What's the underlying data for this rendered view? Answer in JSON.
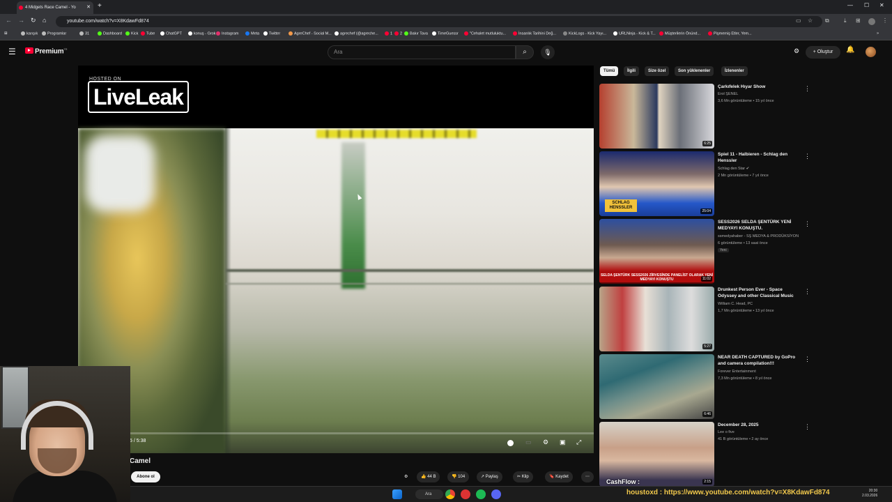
{
  "browser": {
    "tab_title": "4 Midgets Race Camel - Yo",
    "url": "youtube.com/watch?v=X8KdawFd874",
    "bookmarks": [
      {
        "label": "karışık",
        "color": "#bbbbbb"
      },
      {
        "label": "Programlar",
        "color": "#bbbbbb"
      },
      {
        "label": "31",
        "color": "#bbbbbb"
      },
      {
        "label": "Dashboard",
        "color": "#53fc18"
      },
      {
        "label": "Kick",
        "color": "#53fc18"
      },
      {
        "label": "Tube",
        "color": "#ff0033"
      },
      {
        "label": "ChatGPT",
        "color": "#ffffff"
      },
      {
        "label": "konuş - Grok",
        "color": "#ffffff"
      },
      {
        "label": "Instagram",
        "color": "#e1306c"
      },
      {
        "label": "Meta",
        "color": "#1877f2"
      },
      {
        "label": "Twitter",
        "color": "#ffffff"
      },
      {
        "label": "AgreChef - Social M...",
        "color": "#f2994a"
      },
      {
        "label": "agrechef (@agreche...",
        "color": "#ffffff"
      },
      {
        "label": "1",
        "color": "#ff0033"
      },
      {
        "label": "2",
        "color": "#ff0033"
      },
      {
        "label": "Bakır Tava",
        "color": "#53fc18"
      },
      {
        "label": "TimeGuessr",
        "color": "#ffffff"
      },
      {
        "label": "\"Cehalet mutluluktu...",
        "color": "#ff0033"
      },
      {
        "label": "İnsanlık Tarihini Değ...",
        "color": "#ff0033"
      },
      {
        "label": "KickLogs - Kick Yayı...",
        "color": "#888888"
      },
      {
        "label": "URLNinja - Kick & T...",
        "color": "#ffffff"
      },
      {
        "label": "Müşterilerin Önünd...",
        "color": "#ff0033"
      },
      {
        "label": "Pişmemiş Etler, Yem...",
        "color": "#ff0033"
      }
    ]
  },
  "youtube": {
    "logo_text": "Premium",
    "logo_region": "TR",
    "search_placeholder": "Ara",
    "create_label": "Oluştur"
  },
  "player": {
    "hosted_on": "HOSTED ON",
    "watermark": "LiveLeak",
    "time_readout": "5 / 5:38",
    "progress": 0.015
  },
  "video": {
    "title_visible": "Camel",
    "subscribe_label": "Abone ol",
    "likes": "44 B",
    "dislikes": "104",
    "share_label": "Paylaş",
    "clip_label": "Klip",
    "save_label": "Kaydet"
  },
  "filters": [
    "Tümü",
    "İlgili",
    "Size özel",
    "Son yüklenenler",
    "İzlenenler"
  ],
  "recommendations": [
    {
      "title": "Çarkıfelek Hıyar Show",
      "channel": "Erol ŞENEL",
      "meta": "3,6 Mn görüntüleme • 15 yıl önce",
      "duration": "6:25",
      "badge": "",
      "verified": false
    },
    {
      "title": "Spiel 11 - Halbieren - Schlag den Henssler",
      "channel": "Schlag den Star",
      "meta": "2 Mn görüntüleme • 7 yıl önce",
      "duration": "25:04",
      "badge": "",
      "verified": true
    },
    {
      "title": "SESS2026 SELDA ŞENTÜRK YENİ MEDYAYI KONUŞTU.",
      "channel": "ssmedyahaber - SŞ MEDYA & PRODÜKSİYON",
      "meta": "6 görüntüleme • 13 saat önce",
      "duration": "11:02",
      "badge": "Yeni",
      "verified": false
    },
    {
      "title": "Drunkest Person Ever - Space Odyssey and other Classical Music",
      "channel": "William C. Head, PC",
      "meta": "1,7 Mn görüntüleme • 13 yıl önce",
      "duration": "5:27",
      "badge": "",
      "verified": false
    },
    {
      "title": "NEAR DEATH CAPTURED by GoPro and camera compilation!!!",
      "channel": "Forever Entertainment",
      "meta": "7,3 Mn görüntüleme • 8 yıl önce",
      "duration": "6:46",
      "badge": "",
      "verified": false
    },
    {
      "title": "December 28, 2025",
      "channel": "Lee o five",
      "meta": "41 B görüntüleme • 2 ay önce",
      "duration": "2:15",
      "badge": "",
      "verified": false
    }
  ],
  "thumb_captions": {
    "schlag": "SCHLAG HENSSLER",
    "selda": "SELDA ŞENTÜRK SESS2026 ZİRVESİNDE PANELİST OLARAK YENİ MEDYAYI KONUŞTU",
    "cashflow": "CashFlow :"
  },
  "taskbar": {
    "search_label": "Ara",
    "ticker": "houstoxd : https://www.youtube.com/watch?v=X8KdawFd874",
    "time": "20:30",
    "date": "2.03.2026"
  }
}
